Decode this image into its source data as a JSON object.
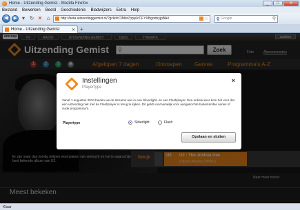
{
  "window": {
    "title": "Home - Uitzending Gemist - Mozilla Firefox",
    "buttons": [
      "_",
      "□",
      "✕"
    ]
  },
  "menu": [
    "Bestand",
    "Bewerken",
    "Beeld",
    "Geschiedenis",
    "Bladwijzers",
    "Extra",
    "Help"
  ],
  "navbar": {
    "url": "http://beta.uitzendinggemist.nl/?gclid=CIMbr7ppy6cCFYXBgodnyjpBA#",
    "search_placeholder": "Google"
  },
  "tab": {
    "label": "Home - Uitzending Gemist"
  },
  "site": {
    "topnav": {
      "logo": "omroep",
      "items": [
        "TV",
        "RADIO",
        "UITZENDING GEMIST",
        "GIDS",
        "THEMA'S"
      ],
      "search_button": "zoeken"
    },
    "header": {
      "title": "Uitzending Gemist",
      "search_button": "Zoek",
      "favorites": "Foto",
      "subscriptions": "Abonnementen"
    },
    "subnav": {
      "items": [
        "Afgelopen 7 dagen",
        "Omroepen",
        "Genres",
        "Programma's A-Z"
      ]
    },
    "hero": {
      "caption": "Er zijn maar dan twintig miljoen exemplaren van verkocht en het is waarschijnlijk het best bekende album van U2."
    },
    "bekijk": {
      "label": "Bekijk",
      "code": "U2",
      "title": "U2 - The Joshua tree",
      "subtitle": "Classic Albums (VPRO)"
    },
    "meer_link": "Naar meer tracks",
    "section_title": "Meest bekeken"
  },
  "modal": {
    "title": "Instellingen",
    "subtitle": "Playertype",
    "body": "Vanaf 1 augustus 2010 bieden we de streams aan in een Silverlight- en een Flashplayer. Een enkele keer kom het voor dat een uitzending niet met de Flashplayer is terug te kijken. Dit geldt voornamelijk voor aangekochte buitenlandse series of oude programma's.",
    "field_label": "Playertype",
    "options": [
      {
        "label": "Silverlight",
        "selected": true
      },
      {
        "label": "Flash",
        "selected": false
      }
    ],
    "save_button": "Opslaan en sluiten",
    "close_symbol": "×"
  },
  "status": {
    "text": "Klaar"
  },
  "colors": {
    "accent": "#f28a1a",
    "site_bg": "#1e1e1e"
  }
}
